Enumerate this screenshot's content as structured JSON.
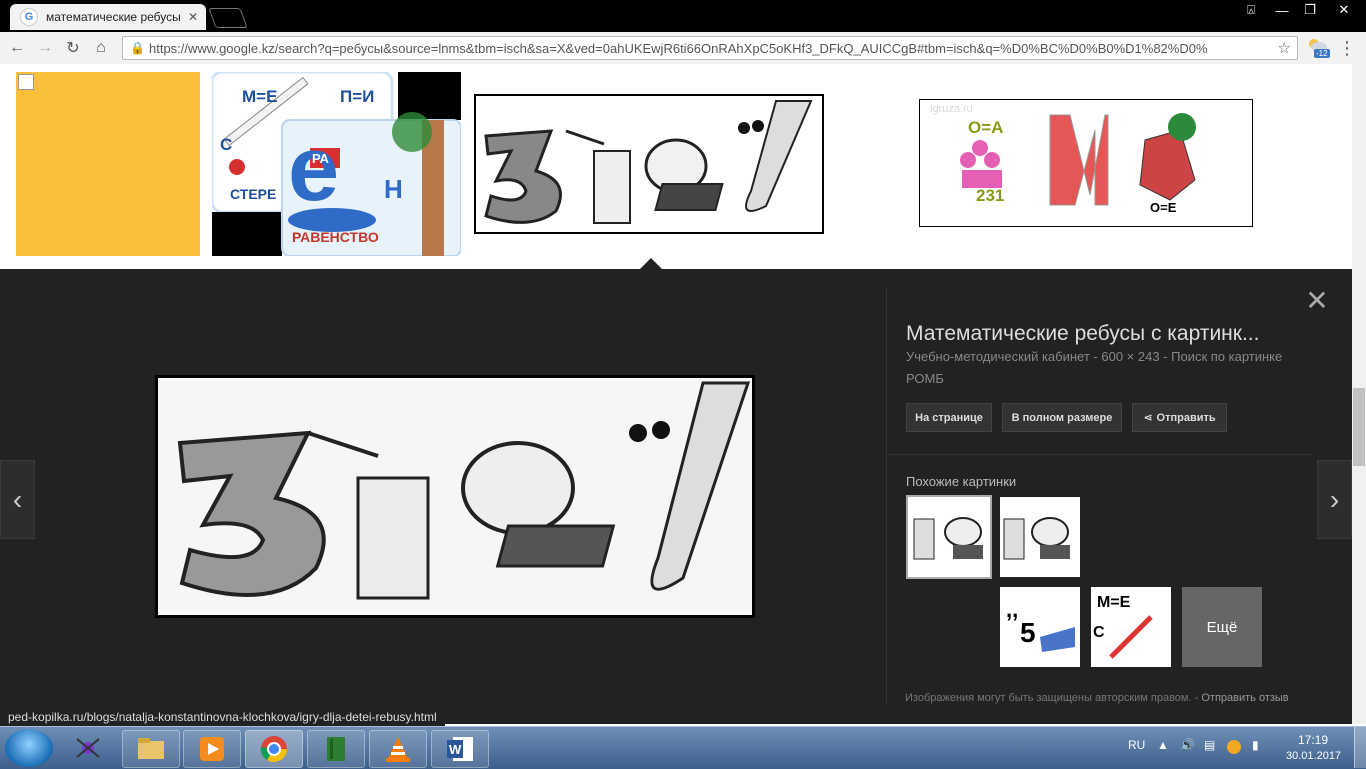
{
  "browser": {
    "tab_title": "математические ребусы",
    "tab_close": "✕",
    "url": "https://www.google.kz/search?q=ребусы&source=lnms&tbm=isch&sa=X&ved=0ahUKEwjR6ti66OnRAhXpC5oKHf3_DFkQ_AUICCgB#tbm=isch&q=%D0%BC%D0%B0%D1%82%D0%",
    "badge": "-12",
    "window_controls": {
      "user": "⍓",
      "minimize": "—",
      "restore": "❐",
      "close": "✕"
    },
    "nav": {
      "back": "←",
      "forward": "→",
      "reload": "↻",
      "home": "⌂",
      "star": "☆",
      "menu": "⋮"
    }
  },
  "thumbs": {
    "t2_labels": [
      "М=Е",
      "П=И",
      "С",
      "СТЕРЕ",
      "е",
      "Н",
      "РА",
      "РАВЕНСТВО"
    ],
    "t4_labels": [
      "О=А",
      "231",
      "И",
      "О=Е",
      "igruza.ru"
    ]
  },
  "preview": {
    "title": "Математические ребусы с картинк...",
    "meta_line1": "Учебно-методический кабинет - 600 × 243 - Поиск по картинке",
    "meta_line2": "РОМБ",
    "btn_page": "На странице",
    "btn_full": "В полном размере",
    "btn_share": "Отправить",
    "similar_header": "Похожие картинки",
    "more": "Ещё",
    "copyright": "Изображения могут быть защищены авторским правом.",
    "feedback": "Отправить отзыв",
    "close": "✕",
    "prev": "‹",
    "next": "›"
  },
  "status_url": "ped-kopilka.ru/blogs/natalja-konstantinovna-klochkova/igry-dlja-detei-rebusy.html",
  "taskbar": {
    "lang": "RU",
    "time": "17:19",
    "date": "30.01.2017"
  }
}
